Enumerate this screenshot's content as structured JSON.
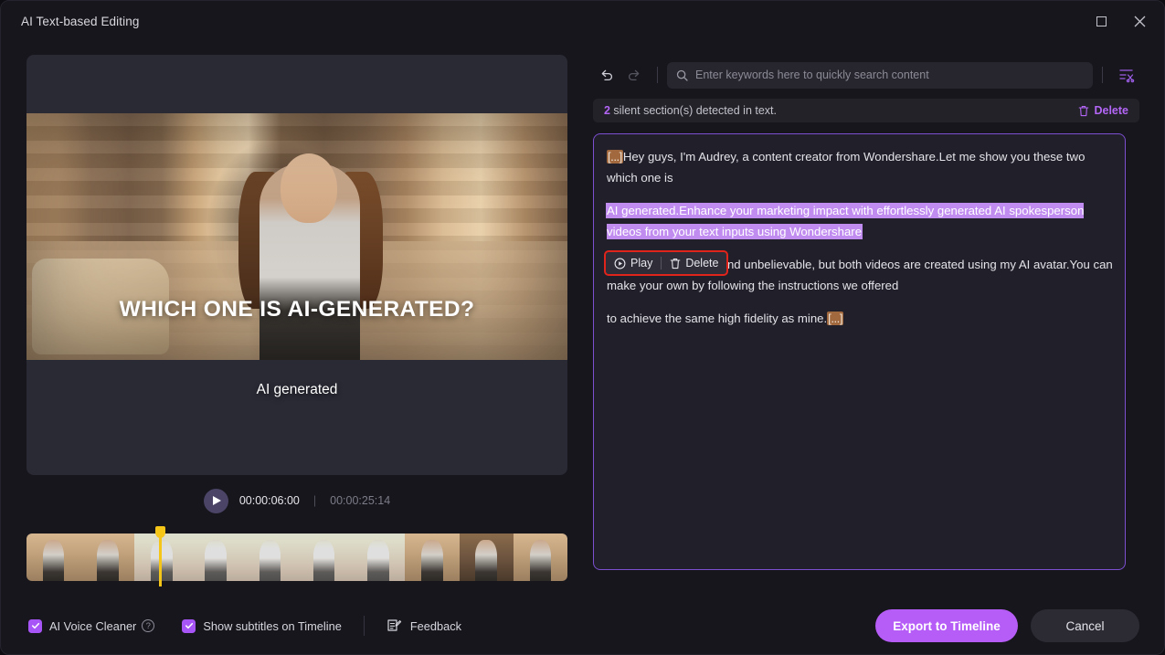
{
  "window": {
    "title": "AI Text-based Editing",
    "controls": {
      "maximize": "maximize-icon",
      "close": "close-icon"
    }
  },
  "preview": {
    "subtitle_main": "WHICH ONE IS AI-GENERATED?",
    "subtitle_small": "AI generated",
    "transport": {
      "play_icon": "play-icon",
      "current_time": "00:00:06:00",
      "separator": "|",
      "total_time": "00:00:25:14"
    },
    "timeline": {
      "playhead_color": "#f5c518"
    }
  },
  "toolbar": {
    "undo_icon": "undo-icon",
    "redo_icon": "redo-icon",
    "search": {
      "icon": "search-icon",
      "value": "",
      "placeholder": "Enter keywords here to quickly search content"
    },
    "text_cut_icon": "text-cut-icon"
  },
  "silent_bar": {
    "count": "2",
    "text": " silent section(s) detected in text.",
    "delete_label": "Delete",
    "delete_icon": "trash-icon",
    "accent": "#b366f5"
  },
  "transcript": {
    "border_color": "#7b4fd0",
    "silent_marker": "[...]",
    "segments": [
      {
        "lead_silent": "[...]",
        "text_before": "Hey guys, I'm Audrey, a content creator from Wondershare.Let me show you these two ",
        "text_after": "which one is"
      },
      {
        "highlighted": "AI generated.Enhance your marketing impact with effortlessly generated AI spokesperson videos from your text inputs using Wondershare"
      },
      {
        "text": " Verbo.OK, it might sound unbelievable, but both videos are created using my AI avatar.You can make your own by following the instructions we offered"
      },
      {
        "text": " to achieve the same high fidelity as mine.",
        "trail_silent": "[...]"
      }
    ],
    "popup": {
      "play_label": "Play",
      "play_icon": "play-circle-icon",
      "delete_label": "Delete",
      "delete_icon": "trash-icon",
      "highlight_border": "#e0241b"
    }
  },
  "footer": {
    "voice_cleaner": {
      "label": "AI Voice Cleaner",
      "checked": true,
      "help_icon": "question-icon",
      "help_char": "?"
    },
    "subtitles": {
      "label": "Show subtitles on Timeline",
      "checked": true
    },
    "feedback": {
      "label": "Feedback",
      "icon": "feedback-icon"
    },
    "export_label": "Export to Timeline",
    "cancel_label": "Cancel",
    "primary_color": "#b65cf7"
  }
}
